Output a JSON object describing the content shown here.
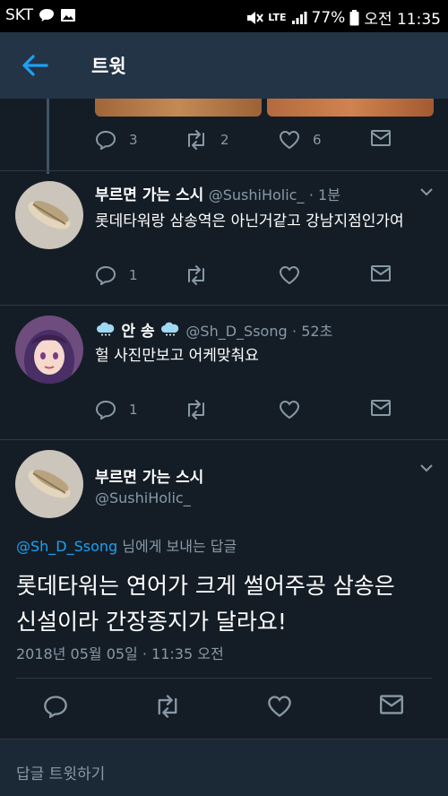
{
  "status_bar": {
    "carrier": "SKT",
    "network": "LTE",
    "battery": "77%",
    "time": "오전 11:35"
  },
  "header": {
    "title": "트윗"
  },
  "top_tweet": {
    "replies": "3",
    "retweets": "2",
    "likes": "6"
  },
  "reply1": {
    "name": "부르면 가는 스시",
    "handle": "@SushiHolic_",
    "time": "· 1분",
    "text": "롯데타워랑 삼송역은 아닌거같고 강남지점인가여",
    "replies": "1"
  },
  "reply2": {
    "name": "안 송",
    "handle": "@Sh_D_Ssong",
    "time": "· 52초",
    "text": "헐 사진만보고 어케맞춰요",
    "replies": "1"
  },
  "main_tweet": {
    "name": "부르면 가는 스시",
    "handle": "@SushiHolic_",
    "reply_to_handle": "@Sh_D_Ssong",
    "reply_to_suffix": "님에게 보내는 답글",
    "line1": "롯데타워는 연어가 크게 썰어주공 삼송은",
    "line2": "신설이라 간장종지가 달라요!",
    "date": "2018년 05월 05일",
    "time": "· 11:35 오전"
  },
  "composer": {
    "placeholder": "답글 트윗하기"
  },
  "icons": {
    "back": "arrow-left-icon",
    "reply": "comment-bubble-icon",
    "retweet": "retweet-icon",
    "like": "heart-icon",
    "dm": "envelope-icon",
    "more": "chevron-down-icon"
  },
  "colors": {
    "background": "#141d26",
    "header": "#243447",
    "accent": "#1da1f2",
    "muted": "#8899a6"
  }
}
